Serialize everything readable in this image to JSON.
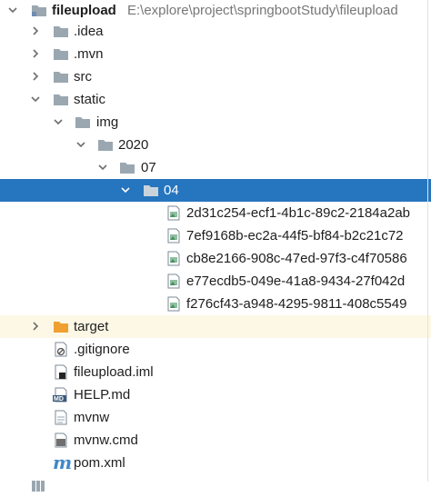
{
  "project": {
    "name": "fileupload",
    "path": "E:\\explore\\project\\springbootStudy\\fileupload"
  },
  "folders": {
    "idea": ".idea",
    "mvn": ".mvn",
    "src": "src",
    "static": "static",
    "img": "img",
    "year": "2020",
    "month": "07",
    "day": "04",
    "target": "target"
  },
  "images": [
    "2d31c254-ecf1-4b1c-89c2-2184a2ab",
    "7ef9168b-ec2a-44f5-bf84-b2c21c72",
    "cb8e2166-908c-47ed-97f3-c4f70586",
    "e77ecdb5-049e-41a8-9434-27f042d",
    "f276cf43-a948-4295-9811-408c5549"
  ],
  "files": {
    "gitignore": ".gitignore",
    "iml": "fileupload.iml",
    "help": "HELP.md",
    "mvnw": "mvnw",
    "mvnw_cmd": "mvnw.cmd",
    "pom": "pom.xml"
  },
  "icon_badges": {
    "md": "MD",
    "maven": "m"
  },
  "colors": {
    "selection": "#2675bf",
    "folder": "#9aa7b0",
    "folder_excluded": "#f0a030",
    "project_folder": "#6e8cb4",
    "excluded_row": "#fdf8e6"
  }
}
